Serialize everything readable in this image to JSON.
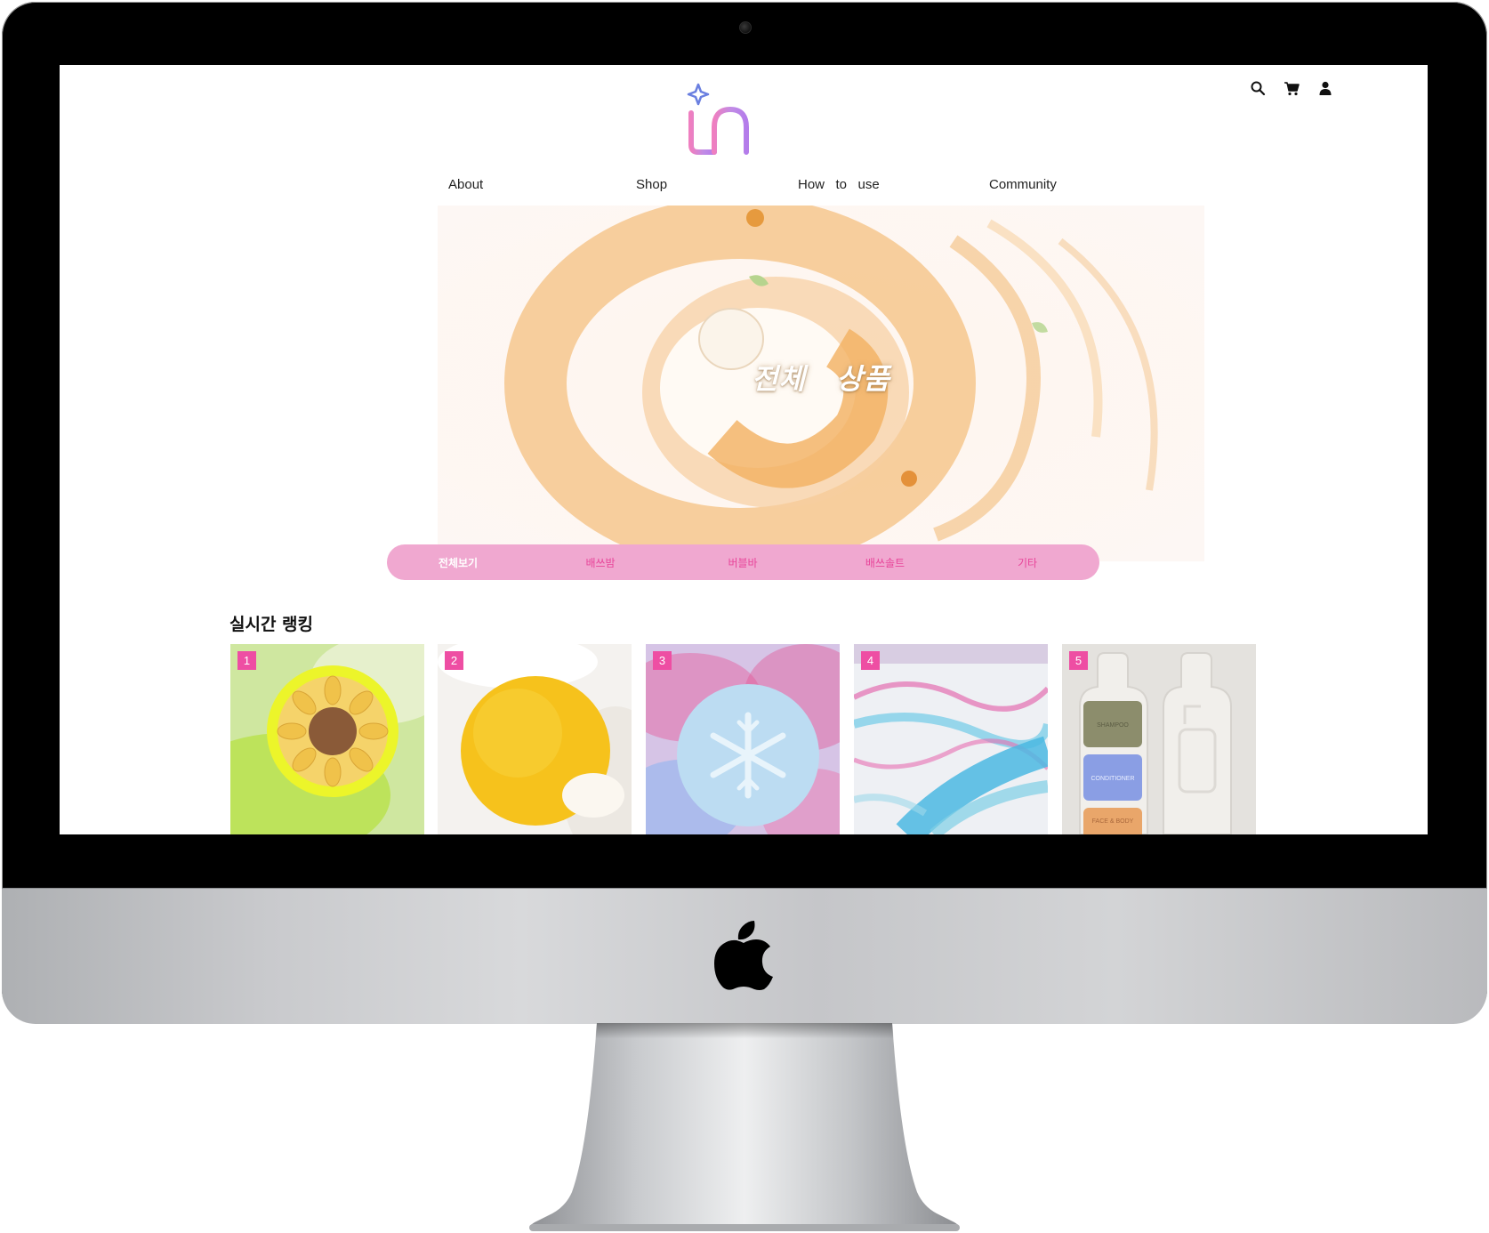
{
  "site": {
    "brand_color": "#e8459a",
    "category_bar_color": "#f0a8d0",
    "badge_color": "#ee4ea3"
  },
  "header": {
    "icons": [
      "search-icon",
      "cart-icon",
      "user-icon"
    ]
  },
  "nav": {
    "items": [
      "About",
      "Shop",
      "How   to   use",
      "Community"
    ]
  },
  "hero": {
    "title": "전체   상품"
  },
  "categories": {
    "items": [
      "전체보기",
      "배쓰밤",
      "버블바",
      "배쓰솔트",
      "기타"
    ],
    "active_index": 0
  },
  "ranking": {
    "title": "실시간 랭킹",
    "items": [
      {
        "rank": "1"
      },
      {
        "rank": "2"
      },
      {
        "rank": "3"
      },
      {
        "rank": "4"
      },
      {
        "rank": "5"
      }
    ]
  },
  "product_labels": {
    "shampoo": "SHAMPOO",
    "conditioner": "CONDITIONER",
    "face_body": "FACE & BODY"
  }
}
